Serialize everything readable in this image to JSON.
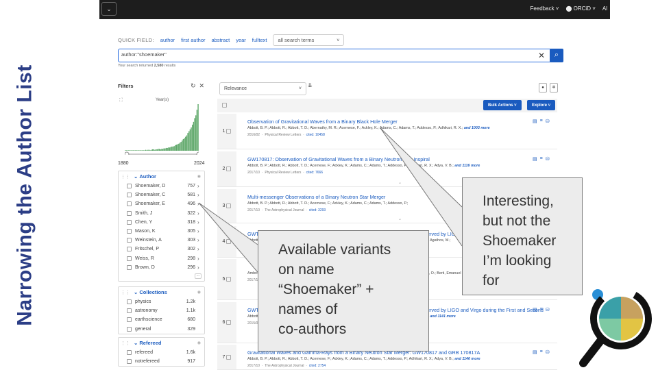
{
  "slide": {
    "title": "Narrowing the Author List"
  },
  "topbar": {
    "menu_icon": "chevron-down-icon",
    "menu_glyph": "⌄",
    "feedback": "Feedback ˅",
    "orcid": "⬤ ORCiD ˅",
    "account": "Al"
  },
  "quick_field": {
    "label": "QUICK FIELD:",
    "links": [
      "author",
      "first author",
      "abstract",
      "year",
      "fulltext"
    ],
    "select_value": "all search terms"
  },
  "search": {
    "query": "author:\"shoemaker\"",
    "clear_glyph": "✕",
    "button_glyph": "⌕"
  },
  "results_summary": {
    "prefix": "Your search returned ",
    "count": "2,580",
    "suffix": " results"
  },
  "filters": {
    "title": "Filters",
    "icons": [
      "refresh-icon",
      "close-icon"
    ],
    "refresh_glyph": "↻",
    "close_glyph": "✕",
    "expand_glyph": "⛶",
    "year_label": "Year(s)",
    "year_min": "1880",
    "year_max": "2024",
    "author_facet": {
      "label": "Author",
      "items": [
        {
          "name": "Shoemaker, D",
          "count": "757"
        },
        {
          "name": "Shoemaker, C",
          "count": "581"
        },
        {
          "name": "Shoemaker, E",
          "count": "496"
        },
        {
          "name": "Smith, J",
          "count": "322"
        },
        {
          "name": "Chen, Y",
          "count": "318"
        },
        {
          "name": "Mason, K",
          "count": "305"
        },
        {
          "name": "Weinstein, A",
          "count": "303"
        },
        {
          "name": "Fritschel, P",
          "count": "302"
        },
        {
          "name": "Weiss, R",
          "count": "298"
        },
        {
          "name": "Brown, D",
          "count": "296"
        }
      ],
      "more": "..."
    },
    "collections_facet": {
      "label": "Collections",
      "items": [
        {
          "name": "physics",
          "count": "1.2k"
        },
        {
          "name": "astronomy",
          "count": "1.1k"
        },
        {
          "name": "earthscience",
          "count": "680"
        },
        {
          "name": "general",
          "count": "329"
        }
      ]
    },
    "refereed_facet": {
      "label": "Refereed",
      "items": [
        {
          "name": "refereed",
          "count": "1.6k"
        },
        {
          "name": "notrefereed",
          "count": "917"
        }
      ]
    }
  },
  "results_toolbar": {
    "sort": "Relevance",
    "bulk_actions": "Bulk Actions ˅",
    "explore": "Explore ˅"
  },
  "results": [
    {
      "index": "1",
      "title": "Observation of Gravitational Waves from a Binary Black Hole Merger",
      "authors": "Abbott, B. P.; Abbott, R.; Abbott, T. D.; Abernathy, M. R.; Acernese, F.; Ackley, K.; Adams, C.; Adams, T.; Addesso, P.; Adhikari, R. X.;",
      "more": "and 1003 more",
      "date": "2016/02",
      "journal": "Physical Review Letters",
      "cited": "cited: 10458"
    },
    {
      "index": "2",
      "title": "GW170817: Observation of Gravitational Waves from a Binary Neutron Star Inspiral",
      "authors": "Abbott, B. P.; Abbott, R.; Abbott, T. D.; Acernese, F.; Ackley, K.; Adams, C.; Adams, T.; Addesso, P.; Adhikari, R. X.; Adya, V. B.;",
      "more": "and 1116 more",
      "date": "2017/10",
      "journal": "Physical Review Letters",
      "cited": "cited: 7666"
    },
    {
      "index": "3",
      "title": "Multi-messenger Observations of a Binary Neutron Star Merger",
      "authors": "Abbott, B. P.; Abbott, R.; Abbott, T. D.; Acernese, F.; Ackley, K.; Adams, C.; Adams, T.; Addesso, P.;",
      "more": "",
      "date": "2017/10",
      "journal": "The Astrophysical Journal",
      "cited": "cited: 3293"
    },
    {
      "index": "4",
      "title": "GWTC-1: A Gravitational-Wave Transient Catalog of Compact Binary Mergers Observed by LIGO and Virgo during the First and Second Part",
      "authors": "Abbott, B. P.; Abbott, R.; Abbott, T. D.; Abraham, S.; Acernese, F.; Ackley, K.; Adams, C.; Adya, V. B.; Affeldt, C.; Agathos, M.;",
      "more": "",
      "date": "",
      "journal": "",
      "cited": ""
    },
    {
      "index": "5",
      "title": "",
      "authors": "Ambrosino, F.; Anand, S.; Andrade, T.; Andres, N.; Angelova, S. V.; Ansoldi, S.; Antier, S.; Antonucci, M.; Arcizet, O.; Berti, Emanuel",
      "more": "",
      "date": "2017/10",
      "journal": "",
      "cited": ""
    },
    {
      "index": "6",
      "title": "GWTC-1: A Gravitational-Wave Transient Catalog of Compact Binary Mergers Observed by LIGO and Virgo during the First and Second",
      "authors": "Abbott, B. P.; Abbott, R.; Abbott, T. D.; Abraham, S.; Acernese, F.; Ackley, K.; Adams, C.; Adya, V. B.; Affeldt, C.;",
      "more": "and 1141 more",
      "date": "2015/06",
      "journal": "",
      "cited": ""
    },
    {
      "index": "7",
      "title": "Gravitational Waves and Gamma-Rays from a Binary Neutron Star Merger: GW170817 and GRB 170817A",
      "authors": "Abbott, B. P.; Abbott, R.; Abbott, T. D.; Acernese, F.; Ackley, K.; Adams, C.; Adams, T.; Addesso, P.; Adhikari, R. X.; Adya, V. B.;",
      "more": "and 1146 more",
      "date": "2017/10",
      "journal": "The Astrophysical Journal",
      "cited": "cited: 2754"
    }
  ],
  "callouts": {
    "variants": [
      "Available variants",
      "on name",
      "“Shoemaker” +",
      "names of",
      "co-authors"
    ],
    "interesting": [
      "Interesting,",
      "but not the",
      "Shoemaker",
      "I’m looking",
      "for"
    ]
  },
  "colors": {
    "title": "#2c3e86",
    "link": "#1a5bbf",
    "topbar": "#1d1d1d",
    "histogram": "#5fa86a",
    "logo_ring": "#111111",
    "logo_dot": "#2a8fd6"
  },
  "histogram_counts": [
    1,
    1,
    1,
    1,
    1,
    1,
    1,
    1,
    1,
    1,
    1,
    1,
    1,
    1,
    1,
    1,
    1,
    1,
    2,
    1,
    2,
    2,
    1,
    2,
    3,
    3,
    2,
    3,
    3,
    4,
    4,
    3,
    4,
    4,
    5,
    5,
    6,
    6,
    7,
    7,
    8,
    9,
    9,
    10,
    12,
    13,
    14,
    15,
    17,
    19,
    22,
    25,
    27,
    30,
    33,
    38,
    42,
    46,
    50,
    56,
    62,
    70,
    76,
    88,
    100
  ]
}
